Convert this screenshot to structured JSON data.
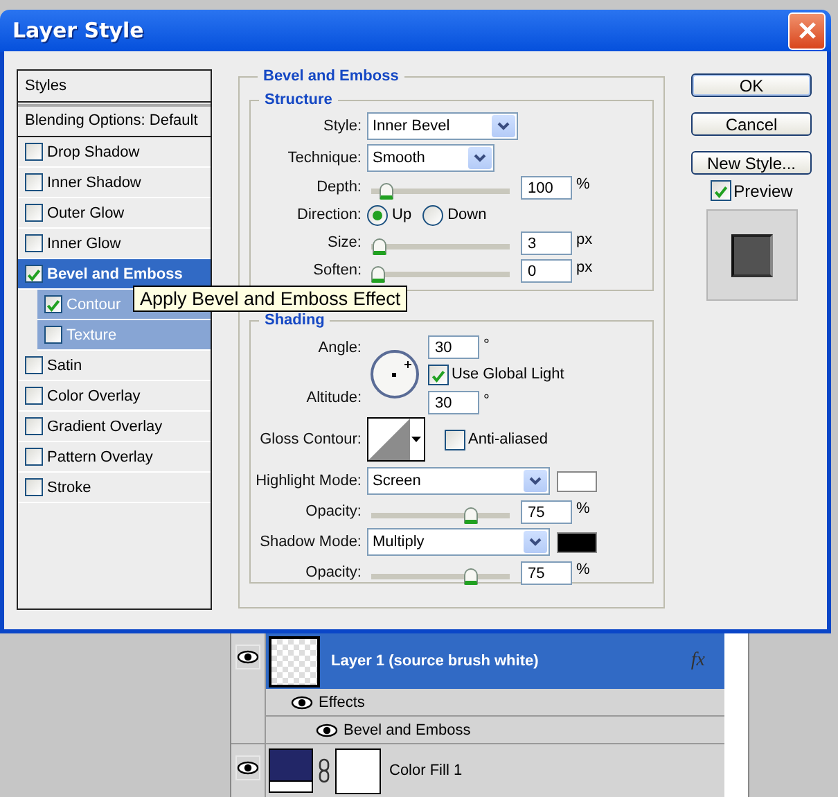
{
  "window": {
    "title": "Layer Style"
  },
  "styles_panel": {
    "header": "Styles",
    "blending_options": "Blending Options: Default",
    "items": [
      {
        "label": "Drop Shadow",
        "checked": false,
        "selected": false
      },
      {
        "label": "Inner Shadow",
        "checked": false,
        "selected": false
      },
      {
        "label": "Outer Glow",
        "checked": false,
        "selected": false
      },
      {
        "label": "Inner Glow",
        "checked": false,
        "selected": false
      },
      {
        "label": "Bevel and Emboss",
        "checked": true,
        "selected": true,
        "children": [
          {
            "label": "Contour",
            "checked": true,
            "selected": false
          },
          {
            "label": "Texture",
            "checked": false,
            "selected": false
          }
        ]
      },
      {
        "label": "Satin",
        "checked": false,
        "selected": false
      },
      {
        "label": "Color Overlay",
        "checked": false,
        "selected": false
      },
      {
        "label": "Gradient Overlay",
        "checked": false,
        "selected": false
      },
      {
        "label": "Pattern Overlay",
        "checked": false,
        "selected": false
      },
      {
        "label": "Stroke",
        "checked": false,
        "selected": false
      }
    ]
  },
  "tooltip": "Apply Bevel and Emboss Effect",
  "bevel_and_emboss": {
    "title": "Bevel and Emboss",
    "structure": {
      "title": "Structure",
      "style": {
        "label": "Style:",
        "value": "Inner Bevel"
      },
      "technique": {
        "label": "Technique:",
        "value": "Smooth"
      },
      "depth": {
        "label": "Depth:",
        "level": 0.07,
        "value": "100",
        "unit": "%"
      },
      "direction": {
        "label": "Direction:",
        "options": [
          {
            "label": "Up",
            "selected": true
          },
          {
            "label": "Down",
            "selected": false
          }
        ]
      },
      "size": {
        "label": "Size:",
        "level": 0.01,
        "value": "3",
        "unit": "px"
      },
      "soften": {
        "label": "Soften:",
        "level": 0,
        "value": "0",
        "unit": "px"
      }
    },
    "shading": {
      "title": "Shading",
      "angle": {
        "label": "Angle:",
        "value": "30",
        "unit": "°"
      },
      "global_light": {
        "label": "Use Global Light",
        "checked": true
      },
      "altitude": {
        "label": "Altitude:",
        "value": "30",
        "unit": "°"
      },
      "gloss_contour": {
        "label": "Gloss Contour:"
      },
      "anti_aliased": {
        "label": "Anti-aliased",
        "checked": false
      },
      "highlight_mode": {
        "label": "Highlight Mode:",
        "value": "Screen",
        "color": "#ffffff"
      },
      "highlight_opacity": {
        "label": "Opacity:",
        "level": 0.76,
        "value": "75",
        "unit": "%"
      },
      "shadow_mode": {
        "label": "Shadow Mode:",
        "value": "Multiply",
        "color": "#000000"
      },
      "shadow_opacity": {
        "label": "Opacity:",
        "level": 0.76,
        "value": "75",
        "unit": "%"
      }
    }
  },
  "buttons": [
    {
      "label": "OK",
      "default": true
    },
    {
      "label": "Cancel",
      "default": false
    },
    {
      "label": "New Style...",
      "default": false
    }
  ],
  "preview": {
    "label": "Preview",
    "checked": true
  },
  "layers": [
    {
      "name": "Layer 1 (source brush white)",
      "kind": "layer",
      "selected": true,
      "visible": true,
      "fx": "fx",
      "effects": {
        "label": "Effects",
        "visible": true,
        "children": [
          {
            "name": "Bevel and Emboss",
            "visible": true
          }
        ]
      }
    },
    {
      "name": "Color Fill 1",
      "kind": "fill",
      "selected": false,
      "visible": true
    }
  ]
}
